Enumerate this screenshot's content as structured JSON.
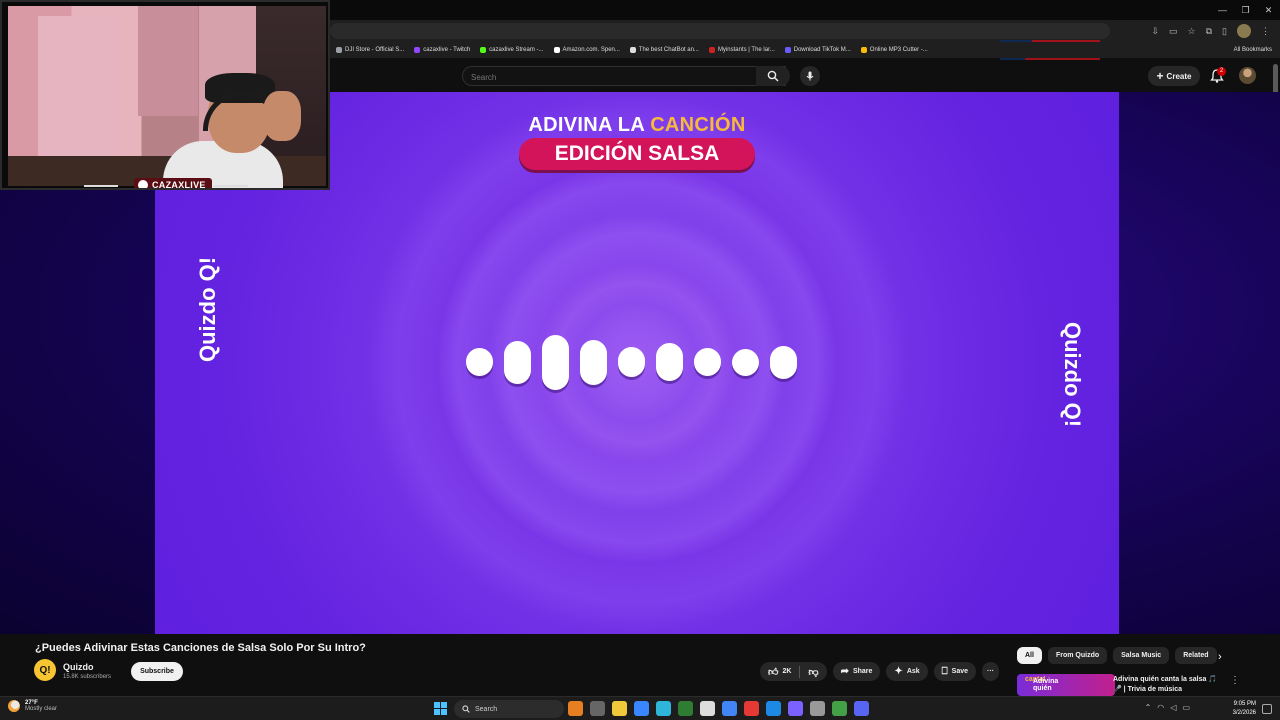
{
  "browser": {
    "bookmarks": [
      {
        "label": "DJI Store - Official S...",
        "color": "#9aa0a6"
      },
      {
        "label": "cazaxlive - Twitch",
        "color": "#9146ff"
      },
      {
        "label": "cazaxlive Stream -...",
        "color": "#53fc18"
      },
      {
        "label": "Amazon.com. Spen...",
        "color": "#ffffff"
      },
      {
        "label": "The best ChatBot an...",
        "color": "#dddddd"
      },
      {
        "label": "Myinstants | The lar...",
        "color": "#cc2222"
      },
      {
        "label": "Download TikTok M...",
        "color": "#6a5cff"
      },
      {
        "label": "Online MP3 Cutter -...",
        "color": "#fbbc05"
      }
    ],
    "all_bookmarks": "All Bookmarks"
  },
  "youtube": {
    "search_placeholder": "Search",
    "create_label": "Create",
    "notification_count": "2"
  },
  "video": {
    "heading_white": "ADIVINA LA",
    "heading_accent": "CANCIÓN",
    "pill_text": "EDICIÓN SALSA",
    "side_logo": "Quizdo",
    "logo_mark": "Q!",
    "audio_bar_levels": [
      0.47,
      0.72,
      0.92,
      0.75,
      0.5,
      0.64,
      0.47,
      0.45,
      0.55
    ],
    "colors": {
      "accent": "#f6b93b",
      "pill": "#d4145a",
      "bg": "#7a38ea"
    }
  },
  "webcam": {
    "label": "CAZAXLIVE"
  },
  "details": {
    "title": "¿Puedes Adivinar Estas Canciones de Salsa Solo Por Su Intro?",
    "channel_logo": "Q!",
    "channel_name": "Quizdo",
    "subscribers": "15.8K subscribers",
    "subscribe_label": "Subscribe",
    "like_count": "2K",
    "share_label": "Share",
    "ask_label": "Ask",
    "save_label": "Save",
    "more_label": "···"
  },
  "chips": [
    "All",
    "From Quizdo",
    "Salsa Music",
    "Related"
  ],
  "related": {
    "thumb_white": "Adivina quién",
    "thumb_accent": "canta!",
    "title": "Adivina quién canta la salsa 🎵🎤 | Trivia de música"
  },
  "taskbar": {
    "temperature": "27°F",
    "condition": "Mostly clear",
    "search_label": "Search",
    "time": "9:05 PM",
    "date": "3/2/2026",
    "app_colors": [
      "#e67e22",
      "#666666",
      "#f0c93a",
      "#3a86ff",
      "#2eb5d9",
      "#2e7d32",
      "#dddddd",
      "#4285f4",
      "#e53935",
      "#1e88e5",
      "#7b61ff",
      "#999999",
      "#43a047",
      "#5865f2"
    ]
  }
}
